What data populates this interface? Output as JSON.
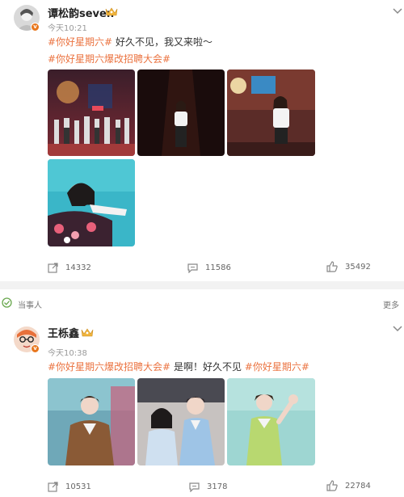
{
  "posts": [
    {
      "user": "谭松韵seven",
      "time": "今天10:21",
      "text": [
        "#你好星期六#",
        " 好久不见，我又来啦～"
      ],
      "text2": "#你好星期六爆改招聘大会#",
      "repost_count": "14332",
      "comment_count": "11586",
      "like_count": "35492"
    },
    {
      "user": "王栎鑫",
      "time": "今天10:38",
      "text": [
        "#你好星期六爆改招聘大会#",
        " 是啊！好久不见 ",
        "#你好星期六#"
      ],
      "repost_count": "10531",
      "comment_count": "3178",
      "like_count": "22784"
    }
  ],
  "related_section": {
    "label": "当事人",
    "more": "更多"
  },
  "colors": {
    "accent_orange": "#eb7340",
    "vip_badge": "#e8761c",
    "crown_gold": "#f0b43c"
  },
  "icons": [
    "repost-icon",
    "comment-icon",
    "like-icon",
    "chevron-down-icon",
    "crown-icon",
    "verified-badge-icon"
  ]
}
